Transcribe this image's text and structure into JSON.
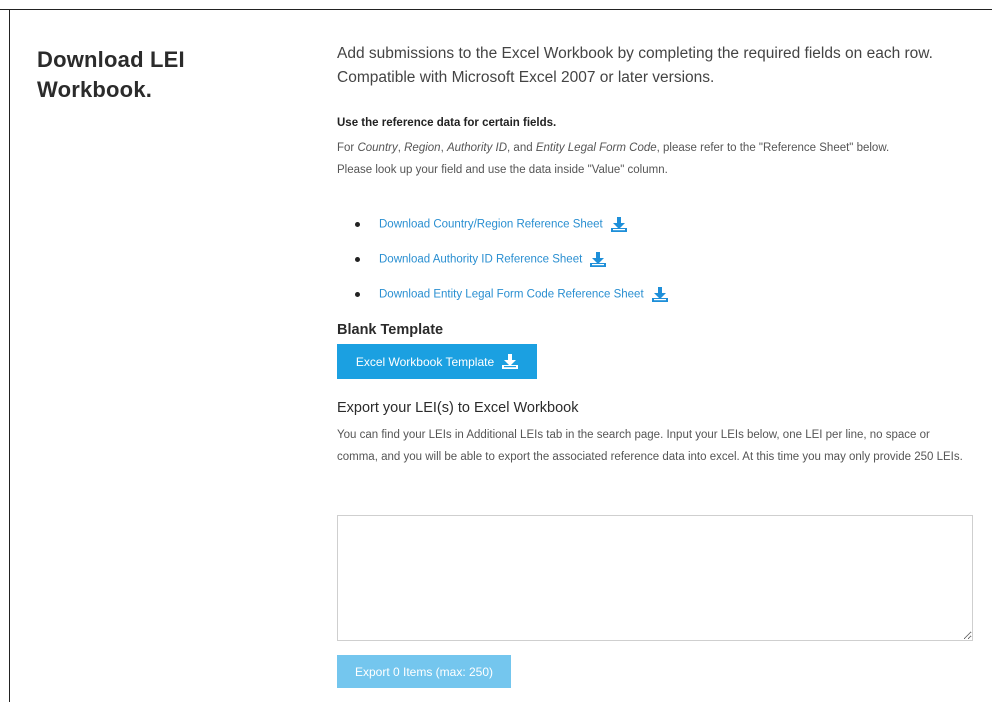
{
  "sidebar": {
    "title_line1": "Download LEI",
    "title_line2": "Workbook."
  },
  "intro": {
    "text": "Add submissions to the Excel Workbook by completing the required fields on each row. Compatible with Microsoft Excel 2007 or later versions."
  },
  "reference": {
    "heading": "Use the reference data for certain fields.",
    "line1_prefix": "For ",
    "field_country": "Country",
    "sep1": ", ",
    "field_region": "Region",
    "sep2": ", ",
    "field_authority": "Authority ID",
    "sep3": ", and ",
    "field_legal_form": "Entity Legal Form Code",
    "line1_suffix": ", please refer to the \"Reference Sheet\" below.",
    "line2": "Please look up your field and use the data inside \"Value\" column.",
    "links": [
      {
        "label": "Download Country/Region Reference Sheet",
        "icon": "download-icon"
      },
      {
        "label": "Download Authority ID Reference Sheet",
        "icon": "download-icon"
      },
      {
        "label": "Download Entity Legal Form Code Reference Sheet",
        "icon": "download-icon"
      }
    ]
  },
  "blank_template": {
    "title": "Blank Template",
    "button_label": "Excel Workbook Template",
    "button_icon": "download-icon"
  },
  "export": {
    "title": "Export your LEI(s) to Excel Workbook",
    "description": "You can find your LEIs in Additional LEIs tab in the search page. Input your LEIs below, one LEI per line, no space or comma, and you will be able to export the associated reference data into excel. At this time you may only provide 250 LEIs.",
    "input_value": "",
    "button_label": "Export 0 Items (max: 250)"
  },
  "colors": {
    "link": "#2a8fd1",
    "primary_button": "#1ba0e1",
    "disabled_button": "#74c6ee"
  }
}
